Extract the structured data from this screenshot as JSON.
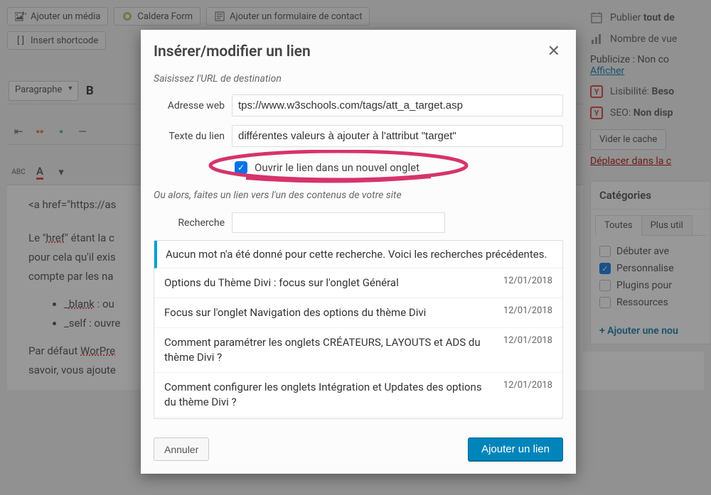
{
  "toolbar": {
    "add_media": "Ajouter un média",
    "caldera": "Caldera Form",
    "add_contact_form": "Ajouter un formulaire de contact",
    "insert_shortcode": "Insert shortcode",
    "paragraph": "Paragraphe"
  },
  "editor_content": {
    "line1_prefix": "<a href=\"https://as",
    "line2_a": "Le \"",
    "line2_href": "href",
    "line2_b": "\" étant la c",
    "line3": "pour cela qu'il exis",
    "line4": "compte par les na",
    "li1_a": "_",
    "li1_b": "blank",
    "li1_c": " : ou",
    "li2": "_self : ouvre",
    "line5_a": "Par défaut ",
    "line5_b": "WorPre",
    "line6": "savoir, vous ajoute"
  },
  "sidebar": {
    "publish": "Publier ",
    "publish_bold": "tout de",
    "stats": "Nombre de vue",
    "publicize_a": "Publicize : Non co",
    "publicize_link": "Afficher",
    "readability_a": "Lisibilité: ",
    "readability_b": "Beso",
    "seo_a": "SEO: ",
    "seo_b": "Non disp",
    "clear_cache": "Vider le cache",
    "trash": "Déplacer dans la c",
    "categories_title": "Catégories",
    "tab_all": "Toutes",
    "tab_used": "Plus util",
    "cats": [
      {
        "label": "Débuter ave",
        "checked": false
      },
      {
        "label": "Personnalise",
        "checked": true
      },
      {
        "label": "Plugins pour",
        "checked": false
      },
      {
        "label": "Ressources",
        "checked": false
      }
    ],
    "add_cat": "+ Ajouter une nou"
  },
  "modal": {
    "title": "Insérer/modifier un lien",
    "help1": "Saisissez l'URL de destination",
    "url_label": "Adresse web",
    "url_value": "tps://www.w3schools.com/tags/att_a_target.asp",
    "text_label": "Texte du lien",
    "text_value": "différentes valeurs à ajouter à l'attribut \"target\"",
    "new_tab": "Ouvrir le lien dans un nouvel onglet",
    "help2": "Ou alors, faites un lien vers l'un des contenus de votre site",
    "search_label": "Recherche",
    "results_header": "Aucun mot n'a été donné pour cette recherche. Voici les recherches précédentes.",
    "results": [
      {
        "title": "Options du Thème Divi : focus sur l'onglet Général",
        "date": "12/01/2018"
      },
      {
        "title": "Focus sur l'onglet Navigation des options du thème Divi",
        "date": "12/01/2018"
      },
      {
        "title": "Comment paramétrer les onglets CRÉATEURS, LAYOUTS et ADS du thème Divi ?",
        "date": "12/01/2018"
      },
      {
        "title": "Comment configurer les onglets Intégration et Updates des options du thème Divi ?",
        "date": "12/01/2018"
      }
    ],
    "cancel": "Annuler",
    "submit": "Ajouter un lien"
  }
}
